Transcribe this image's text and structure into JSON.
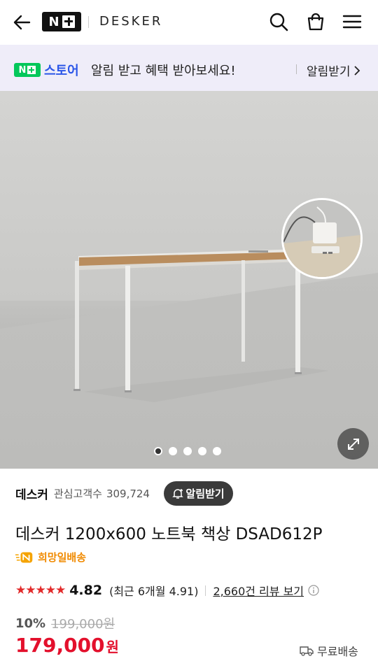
{
  "header": {
    "brand_logo_text": "N",
    "brand": "DESKER",
    "icons": [
      "back-arrow-icon",
      "search-icon",
      "cart-icon",
      "menu-icon"
    ]
  },
  "promo": {
    "store_label": "스토어",
    "store_logo_text": "N",
    "text": "알림 받고 혜택 받아보세요!",
    "cta": "알림받기"
  },
  "gallery": {
    "image_count": 5,
    "active_index": 0
  },
  "store": {
    "name": "데스커",
    "interest_label": "관심고객수",
    "interest_count": "309,724",
    "alarm_button": "알림받기"
  },
  "product": {
    "title": "데스커 1200x600 노트북 책상 DSAD612P",
    "delivery_label": "희망일배송"
  },
  "rating": {
    "stars": "★★★★★",
    "score": "4.82",
    "recent": "(최근 6개월 4.91)",
    "review_link": "2,660건 리뷰 보기"
  },
  "pricing": {
    "discount": "10%",
    "original_price": "199,000원",
    "price": "179,000",
    "currency": "원",
    "shipping": "무료배송"
  },
  "colors": {
    "accent_green": "#03c75a",
    "store_blue": "#2b56e8",
    "price_red": "#e3102c",
    "delivery_orange": "#f08a00",
    "promo_bg": "#efedf9"
  }
}
